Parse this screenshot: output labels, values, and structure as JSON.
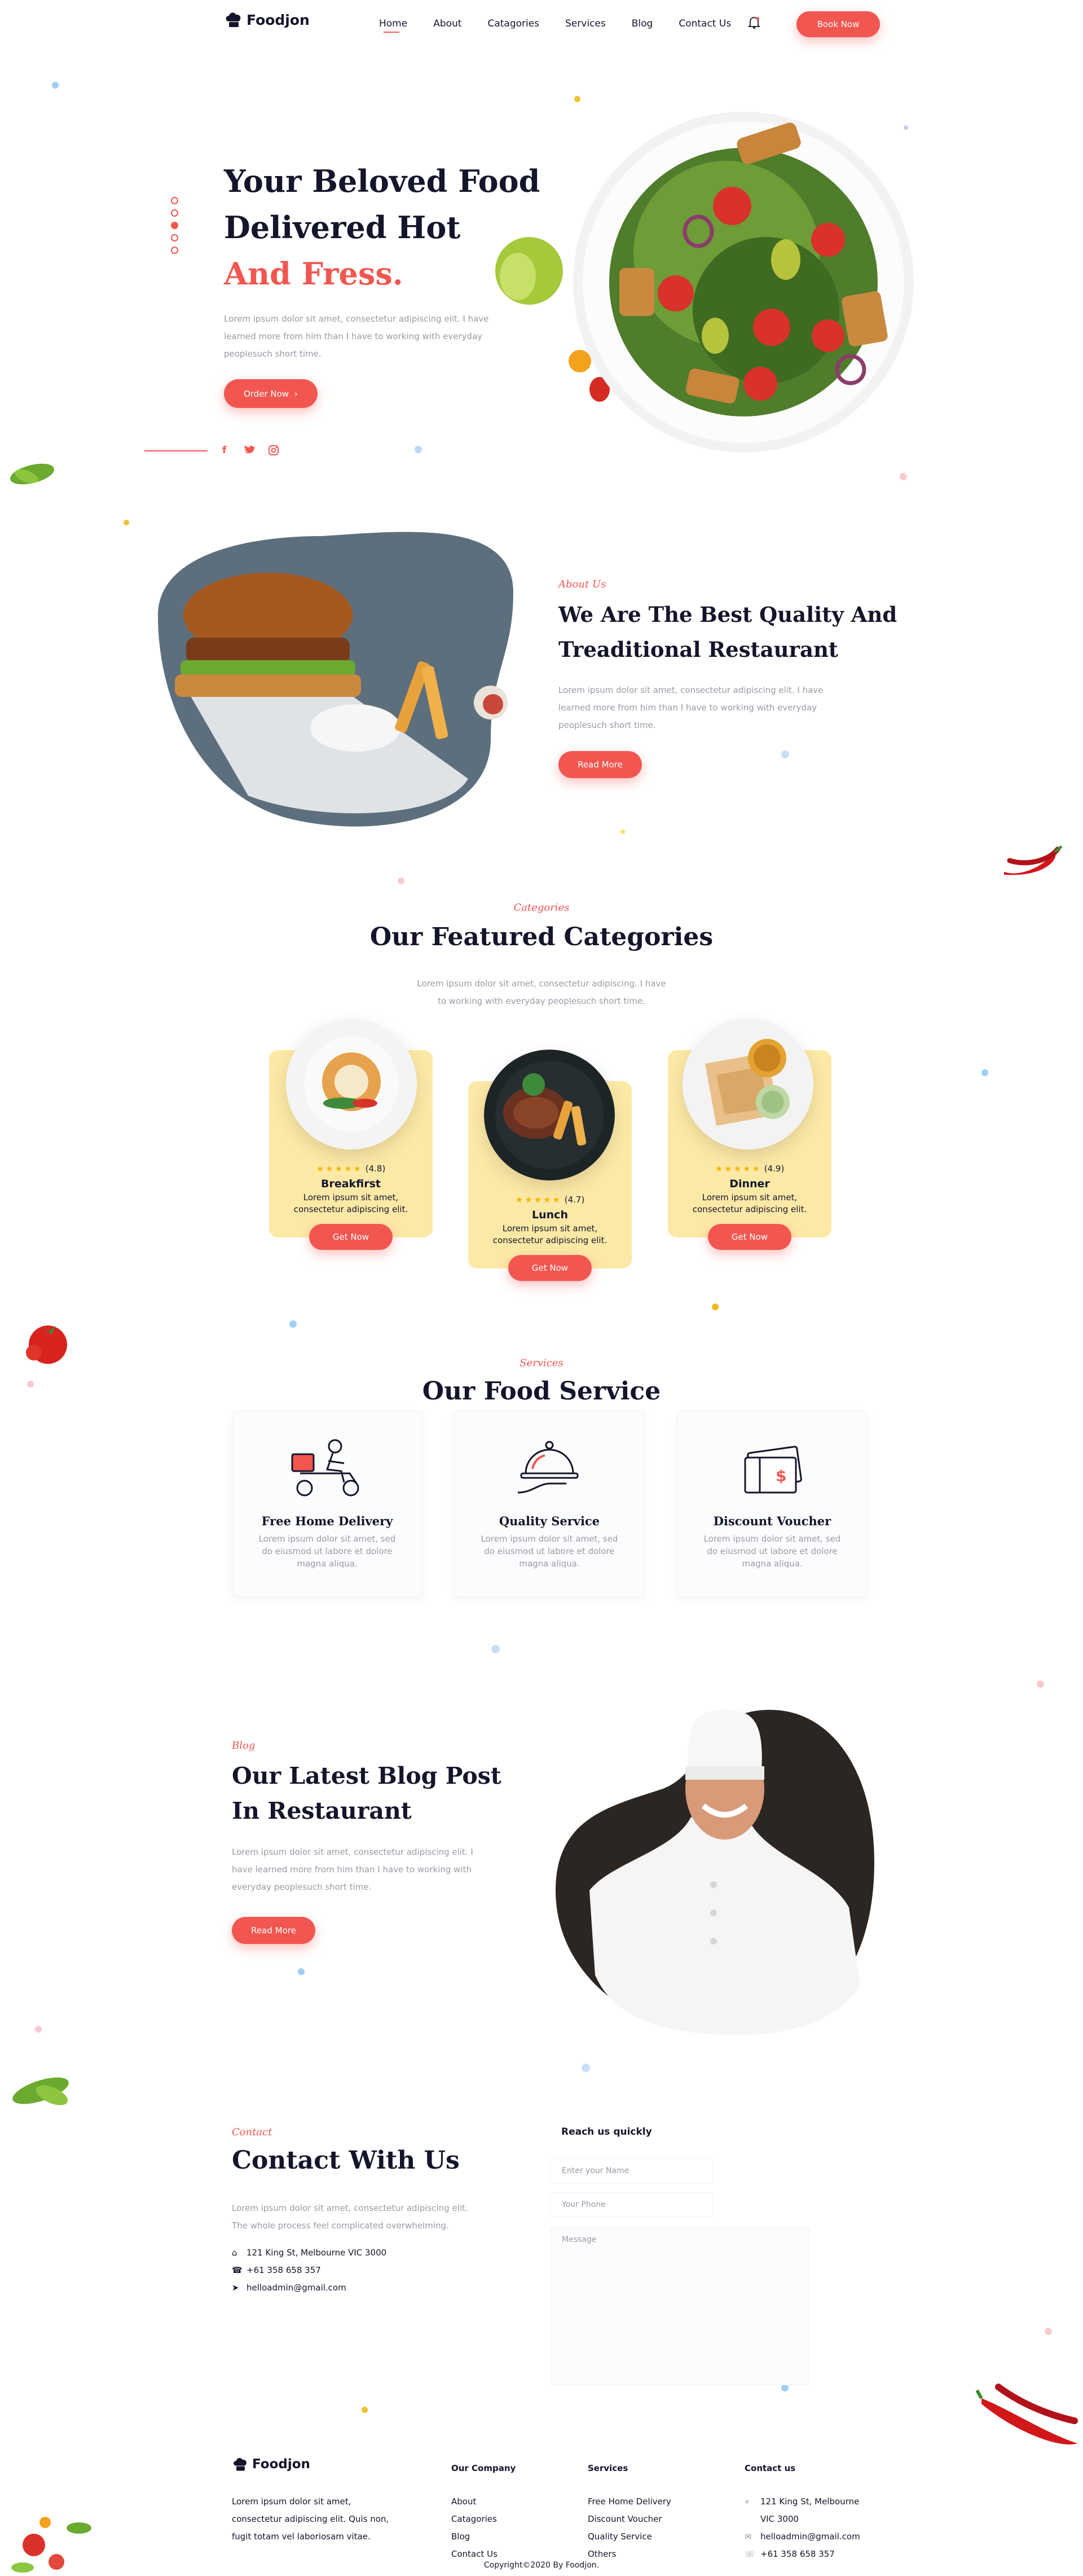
{
  "brand": {
    "logo_text": "Foodjon"
  },
  "nav": {
    "items": [
      "Home",
      "About",
      "Catagories",
      "Services",
      "Blog",
      "Contact Us"
    ],
    "book_label": "Book Now"
  },
  "hero": {
    "title_line1": "Your Beloved Food",
    "title_line2": "Delivered Hot",
    "title_line3": "And Fress.",
    "text": "Lorem ipsum dolor sit amet, consectetur adipiscing elit. I have learned more from him than I have to working with everyday peoplesuch short time.",
    "cta_label": "Order Now"
  },
  "about": {
    "tag": "About Us",
    "title_line1": "We Are The Best Quality And",
    "title_line2": "Treaditional Restaurant",
    "text": "Lorem ipsum dolor sit amet, consectetur adipiscing elit. I have learned more from him than I have to working with everyday peoplesuch short time.",
    "cta_label": "Read More"
  },
  "categories": {
    "tag": "Categories",
    "title": "Our Featured Categories",
    "text": "Lorem ipsum dolor sit amet, consectetur adipiscing. I have to working with everyday peoplesuch short time.",
    "items": [
      {
        "name": "Breakfirst",
        "rating": "(4.8)",
        "desc": "Lorem ipsum sit amet, consectetur adipiscing elit.",
        "cta": "Get Now"
      },
      {
        "name": "Lunch",
        "rating": "(4.7)",
        "desc": "Lorem ipsum sit amet, consectetur adipiscing elit.",
        "cta": "Get Now"
      },
      {
        "name": "Dinner",
        "rating": "(4.9)",
        "desc": "Lorem ipsum sit amet, consectetur adipiscing elit.",
        "cta": "Get Now"
      }
    ]
  },
  "services": {
    "tag": "Services",
    "title": "Our Food Service",
    "items": [
      {
        "title": "Free Home Delivery",
        "desc": "Lorem ipsum dolor sit amet, sed do eiusmod ut labore et dolore magna aliqua.",
        "icon": "delivery-scooter-icon"
      },
      {
        "title": "Quality Service",
        "desc": "Lorem ipsum dolor sit amet, sed do eiusmod ut labore et dolore magna aliqua.",
        "icon": "cloche-icon"
      },
      {
        "title": "Discount Voucher",
        "desc": "Lorem ipsum dolor sit amet, sed do eiusmod ut labore et dolore magna aliqua.",
        "icon": "voucher-icon"
      }
    ]
  },
  "blog": {
    "tag": "Blog",
    "title_line1": "Our Latest Blog Post",
    "title_line2": "In Restaurant",
    "text": "Lorem ipsum dolor sit amet, consectetur adipiscing elit. I have learned more from him than I have to working with everyday peoplesuch short time.",
    "cta_label": "Read More"
  },
  "contact": {
    "tag": "Contact",
    "title": "Contact With Us",
    "text": "Lorem ipsum dolor sit amet, consectetur adipiscing elit. The whole process feel complicated overwhelming.",
    "address": "121 King St, Melbourne VIC 3000",
    "phone": "+61 358 658 357",
    "email": "helloadmin@gmail.com",
    "form_title": "Reach us quickly",
    "name_placeholder": "Enter your Name",
    "phone_placeholder": "Your Phone",
    "message_placeholder": "Message"
  },
  "footer": {
    "about": "Lorem ipsum dolor sit amet, consectetur adipiscing elit. Quis non, fugit totam vel laboriosam vitae.",
    "company_heading": "Our Company",
    "company_links": [
      "About",
      "Catagories",
      "Blog",
      "Contact Us"
    ],
    "services_heading": "Services",
    "services_links": [
      "Free Home Delivery",
      "Discount Voucher",
      "Quality Service",
      "Others"
    ],
    "contact_heading": "Contact us",
    "contact_address_l1": "121 King St, Melbourne",
    "contact_address_l2": "VIC 3000",
    "contact_email": "helloadmin@gmail.com",
    "contact_phone": "+61 358 658 357",
    "copyright": "Copyright©2020 By Foodjon."
  },
  "colors": {
    "accent": "#f25650",
    "card": "#fde9a6",
    "dark": "#14142b",
    "muted": "#9a9aa8"
  }
}
